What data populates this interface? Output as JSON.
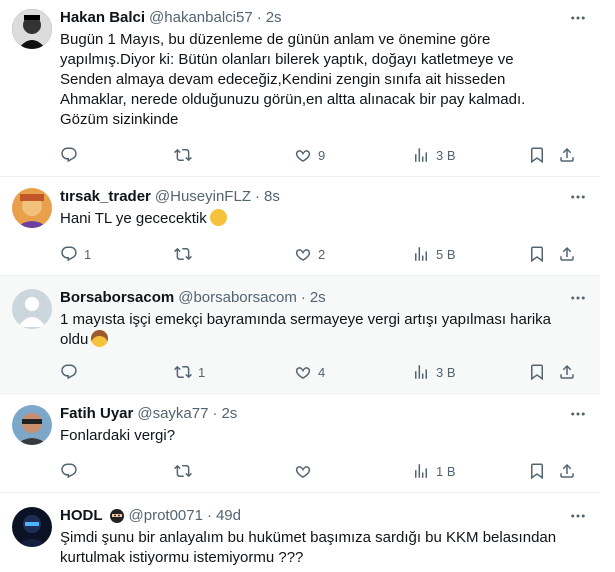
{
  "tweets": [
    {
      "name": "Hakan Balci",
      "handle": "@hakanbalci57",
      "time": "2s",
      "text": "Bugün 1 Mayıs, bu düzenleme de günün anlam ve önemine göre\nyapılmış.Diyor ki: Bütün olanları bilerek yaptık, doğayı katletmeye ve\nSenden almaya devam edeceğiz,Kendini zengin sınıfa ait hisseden\nAhmaklar, nerede olduğunuzu görün,en altta alınacak bir pay kalmadı.\nGözüm sizinkinde",
      "replies": "",
      "retweets": "",
      "likes": "9",
      "views": "3 B"
    },
    {
      "name": "tırsak_trader",
      "handle": "@HuseyinFLZ",
      "time": "8s",
      "text": "Hani TL ye gececektik",
      "emoji": "thinking-face",
      "replies": "1",
      "retweets": "",
      "likes": "2",
      "views": "5 B"
    },
    {
      "name": "Borsaborsacom",
      "handle": "@borsaborsacom",
      "time": "2s",
      "text": "1 mayısta işçi emekçi bayramında sermayeye vergi artışı yapılması harika\noldu",
      "emoji": "cowboy-face",
      "replies": "",
      "retweets": "1",
      "likes": "4",
      "views": "3 B"
    },
    {
      "name": "Fatih Uyar",
      "handle": "@sayka77",
      "time": "2s",
      "text": "Fonlardaki vergi?",
      "replies": "",
      "retweets": "",
      "likes": "",
      "views": "1 B"
    },
    {
      "name": "HODL",
      "name_emoji": "ninja",
      "handle": "@prot0071",
      "time": "49d",
      "text": "Şimdi şunu bir anlayalım bu hukümet başımıza sardığı bu KKM belasından\nkurtulmak istiyormu istemiyormu ???"
    }
  ],
  "separator": "·",
  "colors": {
    "text": "#0f1419",
    "secondary": "#536471",
    "highlight_bg": "#f7f9f9",
    "divider": "#eff3f4"
  },
  "icons": [
    "more-icon",
    "reply-icon",
    "retweet-icon",
    "like-icon",
    "views-icon",
    "bookmark-icon",
    "share-icon"
  ]
}
